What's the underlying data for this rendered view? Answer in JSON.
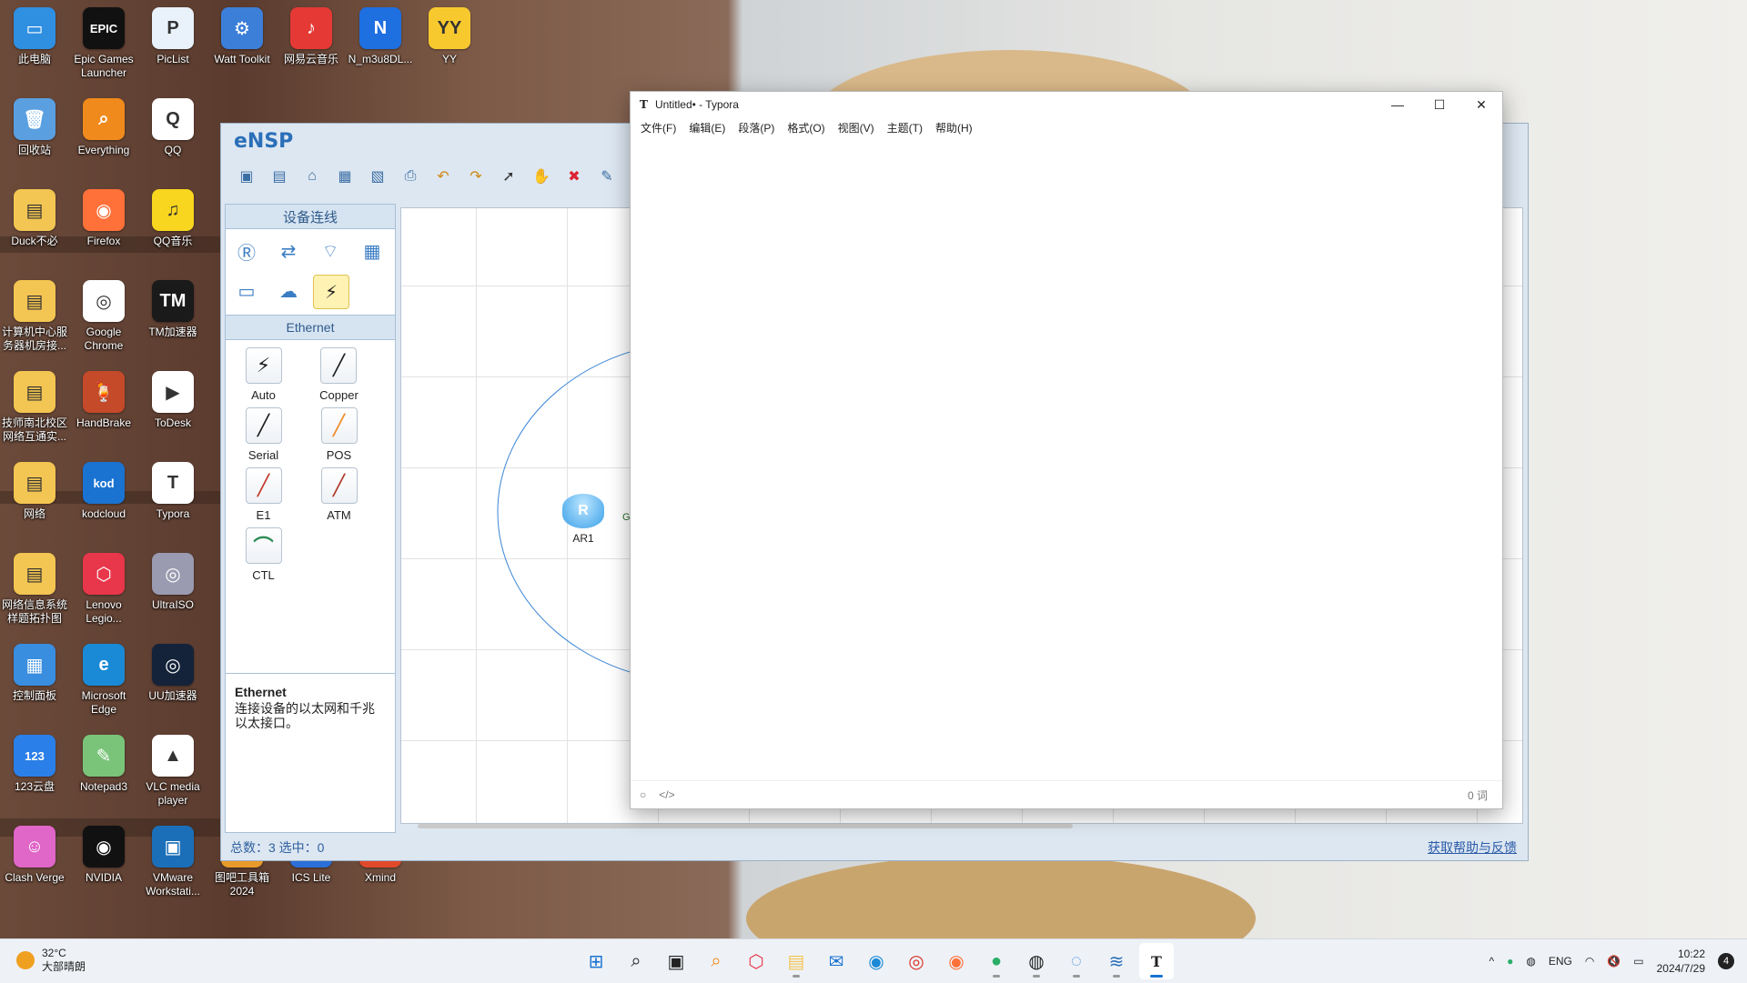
{
  "desktop": {
    "icons": [
      {
        "label": "此电脑",
        "color": "#2f8fe0",
        "glyph": "▭"
      },
      {
        "label": "Epic Games Launcher",
        "color": "#111111",
        "glyph": "EPIC"
      },
      {
        "label": "PicList",
        "color": "#e9f1fb",
        "glyph": "P"
      },
      {
        "label": "Watt Toolkit",
        "color": "#3c7fd8",
        "glyph": "⚙"
      },
      {
        "label": "网易云音乐",
        "color": "#e53935",
        "glyph": "♪"
      },
      {
        "label": "N_m3u8DL...",
        "color": "#1e6fe0",
        "glyph": "N"
      },
      {
        "label": "YY",
        "color": "#f7c92e",
        "glyph": "YY"
      },
      {
        "label": "回收站",
        "color": "#5aa0e0",
        "glyph": "🗑"
      },
      {
        "label": "Everything",
        "color": "#f08a1c",
        "glyph": "⌕"
      },
      {
        "label": "QQ",
        "color": "#ffffff",
        "glyph": "Q"
      },
      {
        "label": "Duck不必",
        "color": "#f3c552",
        "glyph": "▤"
      },
      {
        "label": "Firefox",
        "color": "#ff7139",
        "glyph": "◉"
      },
      {
        "label": "QQ音乐",
        "color": "#f8d51e",
        "glyph": "♫"
      },
      {
        "label": "计算机中心服务器机房接...",
        "color": "#f3c552",
        "glyph": "▤"
      },
      {
        "label": "Google Chrome",
        "color": "#ffffff",
        "glyph": "◎"
      },
      {
        "label": "TM加速器",
        "color": "#1a1a1a",
        "glyph": "TM"
      },
      {
        "label": "技师南北校区网络互通实...",
        "color": "#f3c552",
        "glyph": "▤"
      },
      {
        "label": "HandBrake",
        "color": "#c44a2a",
        "glyph": "🍹"
      },
      {
        "label": "ToDesk",
        "color": "#ffffff",
        "glyph": "▶"
      },
      {
        "label": "网络",
        "color": "#f3c552",
        "glyph": "▤"
      },
      {
        "label": "kodcloud",
        "color": "#1a73d1",
        "glyph": "kod"
      },
      {
        "label": "Typora",
        "color": "#ffffff",
        "glyph": "T"
      },
      {
        "label": "网络信息系统样题拓扑图",
        "color": "#f3c552",
        "glyph": "▤"
      },
      {
        "label": "Lenovo Legio...",
        "color": "#e8364a",
        "glyph": "⬡"
      },
      {
        "label": "UltraISO",
        "color": "#9a9ab0",
        "glyph": "◎"
      },
      {
        "label": "控制面板",
        "color": "#3a8ee0",
        "glyph": "▦"
      },
      {
        "label": "Microsoft Edge",
        "color": "#1a8ad6",
        "glyph": "e"
      },
      {
        "label": "UU加速器",
        "color": "#14233a",
        "glyph": "◎"
      },
      {
        "label": "123云盘",
        "color": "#2b7fe8",
        "glyph": "123"
      },
      {
        "label": "Notepad3",
        "color": "#7ac47a",
        "glyph": "✎"
      },
      {
        "label": "VLC media player",
        "color": "#ffffff",
        "glyph": "▲"
      },
      {
        "label": "Clash Verge",
        "color": "#e066c8",
        "glyph": "☺"
      },
      {
        "label": "NVIDIA",
        "color": "#111111",
        "glyph": "◉"
      },
      {
        "label": "VMware Workstati...",
        "color": "#1b6fb8",
        "glyph": "▣"
      },
      {
        "label": "图吧工具箱2024",
        "color": "#e89a2a",
        "glyph": "▧"
      },
      {
        "label": "ICS Lite",
        "color": "#2b6fd8",
        "glyph": "▤"
      },
      {
        "label": "Xmind",
        "color": "#e04a2a",
        "glyph": "X"
      }
    ]
  },
  "ensp": {
    "logo": "eNSP",
    "panel_title": "设备连线",
    "section_title": "Ethernet",
    "cables": [
      {
        "name": "Auto",
        "color": "#222222"
      },
      {
        "name": "Copper",
        "color": "#222222"
      },
      {
        "name": "Serial",
        "color": "#222222"
      },
      {
        "name": "POS",
        "color": "#f08a2a"
      },
      {
        "name": "E1",
        "color": "#c0392b"
      },
      {
        "name": "ATM",
        "color": "#b03a2a"
      },
      {
        "name": "CTL",
        "color": "#2e8b57"
      }
    ],
    "desc_title": "Ethernet",
    "desc_text": "连接设备的以太网和千兆以太接口。",
    "node_label": "AR1",
    "node_port": "G",
    "status": "总数：3 选中：0",
    "help_link": "获取帮助与反馈"
  },
  "typora": {
    "title": "Untitled• - Typora",
    "icon": "T",
    "menu": [
      "文件(F)",
      "编辑(E)",
      "段落(P)",
      "格式(O)",
      "视图(V)",
      "主题(T)",
      "帮助(H)"
    ],
    "word_count": "0 词",
    "source_toggle": "</>"
  },
  "taskbar": {
    "temperature": "32°C",
    "weather": "大部晴朗",
    "lang": "ENG",
    "time": "10:22",
    "date": "2024/7/29",
    "notifications": "4"
  }
}
